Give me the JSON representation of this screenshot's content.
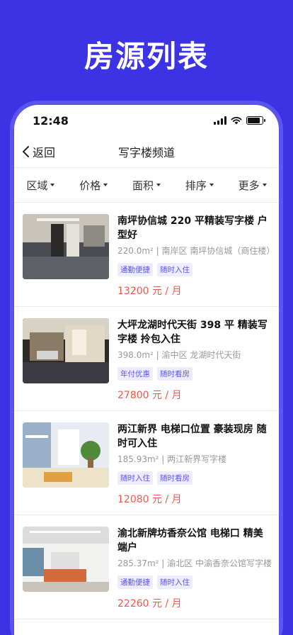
{
  "banner": {
    "title": "房源列表"
  },
  "status": {
    "time": "12:48",
    "battery_level": 0.85
  },
  "nav": {
    "back_label": "返回",
    "title": "写字楼频道"
  },
  "filters": [
    {
      "label": "区域"
    },
    {
      "label": "价格"
    },
    {
      "label": "面积"
    },
    {
      "label": "排序"
    },
    {
      "label": "更多"
    }
  ],
  "listings": [
    {
      "title": "南坪协信城 220 平精装写字楼  户型好",
      "meta": "220.0m²  |  南岸区   南坪协信城（商住楼）",
      "tags": [
        "通勤便捷",
        "随时入住"
      ],
      "price": "13200 元 / 月"
    },
    {
      "title": "大坪龙湖时代天街 398 平  精装写字楼  拎包入住",
      "meta": "398.0m²  |  渝中区   龙湖时代天街",
      "tags": [
        "年付优惠",
        "随时看房"
      ],
      "price": "27800 元 / 月"
    },
    {
      "title": "两江新界 电梯口位置 豪装现房 随时可入住",
      "meta": "185.93m²  |      两江新界写字楼",
      "tags": [
        "随时入住",
        "随时看房"
      ],
      "price": "12080 元 / 月"
    },
    {
      "title": "渝北新牌坊香奈公馆 电梯口 精美端户",
      "meta": "285.37m²  |  渝北区   中渝香奈公馆写字楼",
      "tags": [
        "通勤便捷",
        "随时入住"
      ],
      "price": "22260 元 / 月"
    }
  ]
}
